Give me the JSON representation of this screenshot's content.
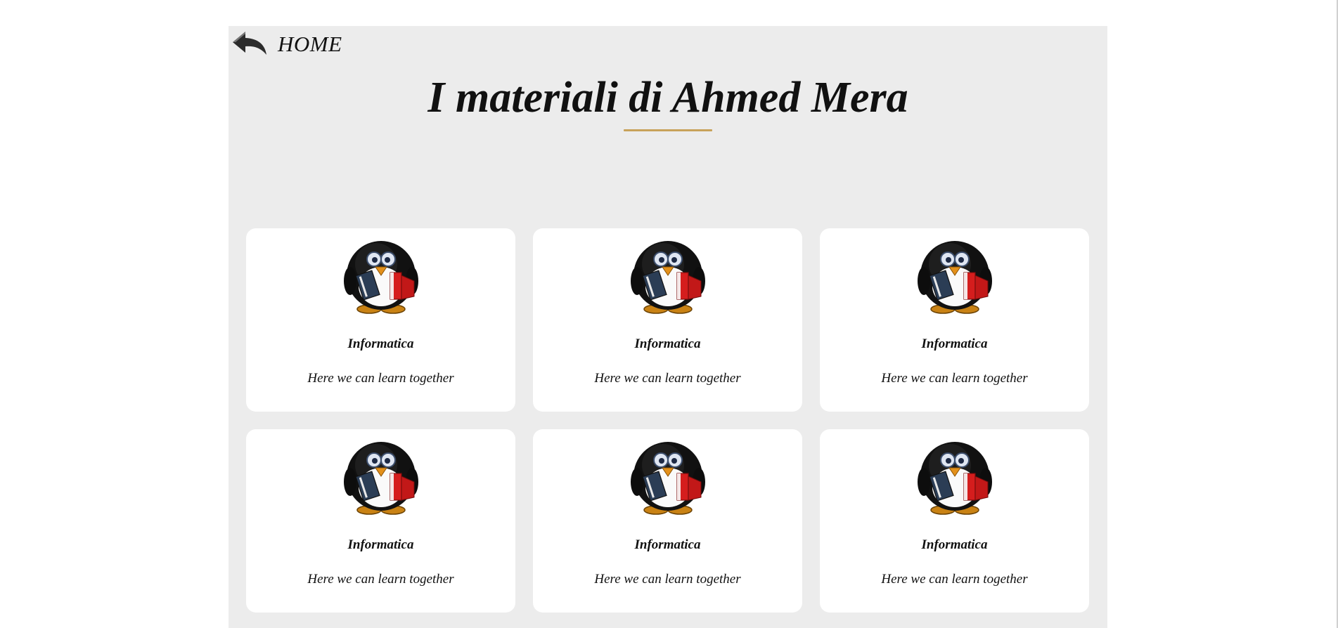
{
  "nav": {
    "home_label": "HOME",
    "home_icon": "back-arrow-icon"
  },
  "header": {
    "title": "I materiali di Ahmed Mera",
    "accent_color": "#c8a25a"
  },
  "cards": [
    {
      "title": "Informatica",
      "description": "Here we can learn together",
      "icon": "penguin-reader-icon"
    },
    {
      "title": "Informatica",
      "description": "Here we can learn together",
      "icon": "penguin-reader-icon"
    },
    {
      "title": "Informatica",
      "description": "Here we can learn together",
      "icon": "penguin-reader-icon"
    },
    {
      "title": "Informatica",
      "description": "Here we can learn together",
      "icon": "penguin-reader-icon"
    },
    {
      "title": "Informatica",
      "description": "Here we can learn together",
      "icon": "penguin-reader-icon"
    },
    {
      "title": "Informatica",
      "description": "Here we can learn together",
      "icon": "penguin-reader-icon"
    }
  ],
  "colors": {
    "page_background": "#ffffff",
    "container_background": "#ececec",
    "card_background": "#ffffff"
  }
}
